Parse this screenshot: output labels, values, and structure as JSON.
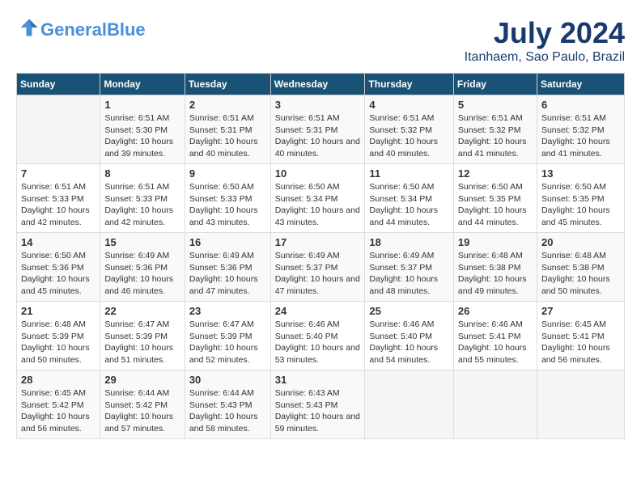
{
  "logo": {
    "text_general": "General",
    "text_blue": "Blue"
  },
  "title": "July 2024",
  "location": "Itanhaem, Sao Paulo, Brazil",
  "days_of_week": [
    "Sunday",
    "Monday",
    "Tuesday",
    "Wednesday",
    "Thursday",
    "Friday",
    "Saturday"
  ],
  "weeks": [
    [
      {
        "day": "",
        "empty": true
      },
      {
        "day": "1",
        "sunrise": "6:51 AM",
        "sunset": "5:30 PM",
        "daylight": "10 hours and 39 minutes."
      },
      {
        "day": "2",
        "sunrise": "6:51 AM",
        "sunset": "5:31 PM",
        "daylight": "10 hours and 40 minutes."
      },
      {
        "day": "3",
        "sunrise": "6:51 AM",
        "sunset": "5:31 PM",
        "daylight": "10 hours and 40 minutes."
      },
      {
        "day": "4",
        "sunrise": "6:51 AM",
        "sunset": "5:32 PM",
        "daylight": "10 hours and 40 minutes."
      },
      {
        "day": "5",
        "sunrise": "6:51 AM",
        "sunset": "5:32 PM",
        "daylight": "10 hours and 41 minutes."
      },
      {
        "day": "6",
        "sunrise": "6:51 AM",
        "sunset": "5:32 PM",
        "daylight": "10 hours and 41 minutes."
      }
    ],
    [
      {
        "day": "7",
        "sunrise": "6:51 AM",
        "sunset": "5:33 PM",
        "daylight": "10 hours and 42 minutes."
      },
      {
        "day": "8",
        "sunrise": "6:51 AM",
        "sunset": "5:33 PM",
        "daylight": "10 hours and 42 minutes."
      },
      {
        "day": "9",
        "sunrise": "6:50 AM",
        "sunset": "5:33 PM",
        "daylight": "10 hours and 43 minutes."
      },
      {
        "day": "10",
        "sunrise": "6:50 AM",
        "sunset": "5:34 PM",
        "daylight": "10 hours and 43 minutes."
      },
      {
        "day": "11",
        "sunrise": "6:50 AM",
        "sunset": "5:34 PM",
        "daylight": "10 hours and 44 minutes."
      },
      {
        "day": "12",
        "sunrise": "6:50 AM",
        "sunset": "5:35 PM",
        "daylight": "10 hours and 44 minutes."
      },
      {
        "day": "13",
        "sunrise": "6:50 AM",
        "sunset": "5:35 PM",
        "daylight": "10 hours and 45 minutes."
      }
    ],
    [
      {
        "day": "14",
        "sunrise": "6:50 AM",
        "sunset": "5:36 PM",
        "daylight": "10 hours and 45 minutes."
      },
      {
        "day": "15",
        "sunrise": "6:49 AM",
        "sunset": "5:36 PM",
        "daylight": "10 hours and 46 minutes."
      },
      {
        "day": "16",
        "sunrise": "6:49 AM",
        "sunset": "5:36 PM",
        "daylight": "10 hours and 47 minutes."
      },
      {
        "day": "17",
        "sunrise": "6:49 AM",
        "sunset": "5:37 PM",
        "daylight": "10 hours and 47 minutes."
      },
      {
        "day": "18",
        "sunrise": "6:49 AM",
        "sunset": "5:37 PM",
        "daylight": "10 hours and 48 minutes."
      },
      {
        "day": "19",
        "sunrise": "6:48 AM",
        "sunset": "5:38 PM",
        "daylight": "10 hours and 49 minutes."
      },
      {
        "day": "20",
        "sunrise": "6:48 AM",
        "sunset": "5:38 PM",
        "daylight": "10 hours and 50 minutes."
      }
    ],
    [
      {
        "day": "21",
        "sunrise": "6:48 AM",
        "sunset": "5:39 PM",
        "daylight": "10 hours and 50 minutes."
      },
      {
        "day": "22",
        "sunrise": "6:47 AM",
        "sunset": "5:39 PM",
        "daylight": "10 hours and 51 minutes."
      },
      {
        "day": "23",
        "sunrise": "6:47 AM",
        "sunset": "5:39 PM",
        "daylight": "10 hours and 52 minutes."
      },
      {
        "day": "24",
        "sunrise": "6:46 AM",
        "sunset": "5:40 PM",
        "daylight": "10 hours and 53 minutes."
      },
      {
        "day": "25",
        "sunrise": "6:46 AM",
        "sunset": "5:40 PM",
        "daylight": "10 hours and 54 minutes."
      },
      {
        "day": "26",
        "sunrise": "6:46 AM",
        "sunset": "5:41 PM",
        "daylight": "10 hours and 55 minutes."
      },
      {
        "day": "27",
        "sunrise": "6:45 AM",
        "sunset": "5:41 PM",
        "daylight": "10 hours and 56 minutes."
      }
    ],
    [
      {
        "day": "28",
        "sunrise": "6:45 AM",
        "sunset": "5:42 PM",
        "daylight": "10 hours and 56 minutes."
      },
      {
        "day": "29",
        "sunrise": "6:44 AM",
        "sunset": "5:42 PM",
        "daylight": "10 hours and 57 minutes."
      },
      {
        "day": "30",
        "sunrise": "6:44 AM",
        "sunset": "5:43 PM",
        "daylight": "10 hours and 58 minutes."
      },
      {
        "day": "31",
        "sunrise": "6:43 AM",
        "sunset": "5:43 PM",
        "daylight": "10 hours and 59 minutes."
      },
      {
        "day": "",
        "empty": true
      },
      {
        "day": "",
        "empty": true
      },
      {
        "day": "",
        "empty": true
      }
    ]
  ]
}
